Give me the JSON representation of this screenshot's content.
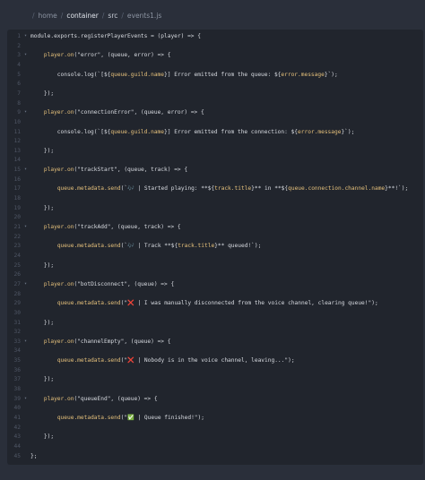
{
  "breadcrumb": {
    "items": [
      "home",
      "container",
      "src",
      "events1.js"
    ],
    "separator": "/"
  },
  "editor": {
    "lines": [
      {
        "n": "1",
        "fold": true,
        "segs": [
          {
            "t": "module.exports.registerPlayerEvents = (player) => {",
            "c": "p"
          }
        ]
      },
      {
        "n": "2",
        "fold": false,
        "segs": []
      },
      {
        "n": "3",
        "fold": true,
        "segs": [
          {
            "t": "    ",
            "c": "p"
          },
          {
            "t": "player.on",
            "c": "k"
          },
          {
            "t": "(\"error\", (queue, error) => {",
            "c": "p"
          }
        ]
      },
      {
        "n": "4",
        "fold": false,
        "segs": []
      },
      {
        "n": "5",
        "fold": false,
        "segs": [
          {
            "t": "        console.log(`[${",
            "c": "p"
          },
          {
            "t": "queue.guild.name",
            "c": "k"
          },
          {
            "t": "}] Error emitted from the queue: ${",
            "c": "p"
          },
          {
            "t": "error.message",
            "c": "k"
          },
          {
            "t": "}`);",
            "c": "p"
          }
        ]
      },
      {
        "n": "6",
        "fold": false,
        "segs": []
      },
      {
        "n": "7",
        "fold": false,
        "segs": [
          {
            "t": "    });",
            "c": "p"
          }
        ]
      },
      {
        "n": "8",
        "fold": false,
        "segs": []
      },
      {
        "n": "9",
        "fold": true,
        "segs": [
          {
            "t": "    ",
            "c": "p"
          },
          {
            "t": "player.on",
            "c": "k"
          },
          {
            "t": "(\"connectionError\", (queue, error) => {",
            "c": "p"
          }
        ]
      },
      {
        "n": "10",
        "fold": false,
        "segs": []
      },
      {
        "n": "11",
        "fold": false,
        "segs": [
          {
            "t": "        console.log(`[${",
            "c": "p"
          },
          {
            "t": "queue.guild.name",
            "c": "k"
          },
          {
            "t": "}] Error emitted from the connection: ${",
            "c": "p"
          },
          {
            "t": "error.message",
            "c": "k"
          },
          {
            "t": "}`);",
            "c": "p"
          }
        ]
      },
      {
        "n": "12",
        "fold": false,
        "segs": []
      },
      {
        "n": "13",
        "fold": false,
        "segs": [
          {
            "t": "    });",
            "c": "p"
          }
        ]
      },
      {
        "n": "14",
        "fold": false,
        "segs": []
      },
      {
        "n": "15",
        "fold": true,
        "segs": [
          {
            "t": "    ",
            "c": "p"
          },
          {
            "t": "player.on",
            "c": "k"
          },
          {
            "t": "(\"trackStart\", (queue, track) => {",
            "c": "p"
          }
        ]
      },
      {
        "n": "16",
        "fold": false,
        "segs": []
      },
      {
        "n": "17",
        "fold": false,
        "segs": [
          {
            "t": "        ",
            "c": "p"
          },
          {
            "t": "queue.metadata.send",
            "c": "k"
          },
          {
            "t": "(`🎶 | Started playing: **${",
            "c": "p"
          },
          {
            "t": "track.title",
            "c": "k"
          },
          {
            "t": "}** in **${",
            "c": "p"
          },
          {
            "t": "queue.connection.channel.name",
            "c": "k"
          },
          {
            "t": "}**!`);",
            "c": "p"
          }
        ]
      },
      {
        "n": "18",
        "fold": false,
        "segs": []
      },
      {
        "n": "19",
        "fold": false,
        "segs": [
          {
            "t": "    });",
            "c": "p"
          }
        ]
      },
      {
        "n": "20",
        "fold": false,
        "segs": []
      },
      {
        "n": "21",
        "fold": true,
        "segs": [
          {
            "t": "    ",
            "c": "p"
          },
          {
            "t": "player.on",
            "c": "k"
          },
          {
            "t": "(\"trackAdd\", (queue, track) => {",
            "c": "p"
          }
        ]
      },
      {
        "n": "22",
        "fold": false,
        "segs": []
      },
      {
        "n": "23",
        "fold": false,
        "segs": [
          {
            "t": "        ",
            "c": "p"
          },
          {
            "t": "queue.metadata.send",
            "c": "k"
          },
          {
            "t": "(`🎶 | Track **${",
            "c": "p"
          },
          {
            "t": "track.title",
            "c": "k"
          },
          {
            "t": "}** queued!`);",
            "c": "p"
          }
        ]
      },
      {
        "n": "24",
        "fold": false,
        "segs": []
      },
      {
        "n": "25",
        "fold": false,
        "segs": [
          {
            "t": "    });",
            "c": "p"
          }
        ]
      },
      {
        "n": "26",
        "fold": false,
        "segs": []
      },
      {
        "n": "27",
        "fold": true,
        "segs": [
          {
            "t": "    ",
            "c": "p"
          },
          {
            "t": "player.on",
            "c": "k"
          },
          {
            "t": "(\"botDisconnect\", (queue) => {",
            "c": "p"
          }
        ]
      },
      {
        "n": "28",
        "fold": false,
        "segs": []
      },
      {
        "n": "29",
        "fold": false,
        "segs": [
          {
            "t": "        ",
            "c": "p"
          },
          {
            "t": "queue.metadata.send",
            "c": "k"
          },
          {
            "t": "(\"❌ | I was manually disconnected from the voice channel, clearing queue!\");",
            "c": "p"
          }
        ]
      },
      {
        "n": "30",
        "fold": false,
        "segs": []
      },
      {
        "n": "31",
        "fold": false,
        "segs": [
          {
            "t": "    });",
            "c": "p"
          }
        ]
      },
      {
        "n": "32",
        "fold": false,
        "segs": []
      },
      {
        "n": "33",
        "fold": true,
        "segs": [
          {
            "t": "    ",
            "c": "p"
          },
          {
            "t": "player.on",
            "c": "k"
          },
          {
            "t": "(\"channelEmpty\", (queue) => {",
            "c": "p"
          }
        ]
      },
      {
        "n": "34",
        "fold": false,
        "segs": []
      },
      {
        "n": "35",
        "fold": false,
        "segs": [
          {
            "t": "        ",
            "c": "p"
          },
          {
            "t": "queue.metadata.send",
            "c": "k"
          },
          {
            "t": "(\"❌ | Nobody is in the voice channel, leaving...\");",
            "c": "p"
          }
        ]
      },
      {
        "n": "36",
        "fold": false,
        "segs": []
      },
      {
        "n": "37",
        "fold": false,
        "segs": [
          {
            "t": "    });",
            "c": "p"
          }
        ]
      },
      {
        "n": "38",
        "fold": false,
        "segs": []
      },
      {
        "n": "39",
        "fold": true,
        "segs": [
          {
            "t": "    ",
            "c": "p"
          },
          {
            "t": "player.on",
            "c": "k"
          },
          {
            "t": "(\"queueEnd\", (queue) => {",
            "c": "p"
          }
        ]
      },
      {
        "n": "40",
        "fold": false,
        "segs": []
      },
      {
        "n": "41",
        "fold": false,
        "segs": [
          {
            "t": "        ",
            "c": "p"
          },
          {
            "t": "queue.metadata.send",
            "c": "k"
          },
          {
            "t": "(\"✅ | Queue finished!\");",
            "c": "p"
          }
        ]
      },
      {
        "n": "42",
        "fold": false,
        "segs": []
      },
      {
        "n": "43",
        "fold": false,
        "segs": [
          {
            "t": "    });",
            "c": "p"
          }
        ]
      },
      {
        "n": "44",
        "fold": false,
        "segs": []
      },
      {
        "n": "45",
        "fold": false,
        "segs": [
          {
            "t": "};",
            "c": "p"
          }
        ]
      }
    ]
  }
}
